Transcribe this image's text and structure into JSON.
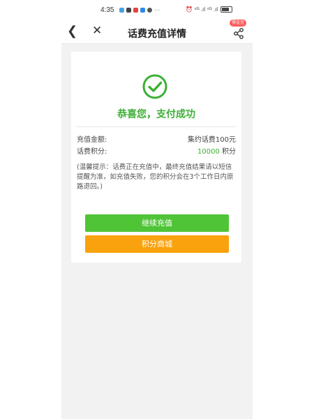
{
  "status_bar": {
    "time": "4:35",
    "right_indicators": "⏰ ⁴ᴳ .ıl ⁴ᴳ .ıl",
    "left_icon_colors": [
      "#4aa3df",
      "#444444",
      "#e0463b",
      "#2e8ae6",
      "#555555"
    ]
  },
  "navbar": {
    "title": "话费充值详情",
    "badge": "得金豆"
  },
  "result": {
    "message": "恭喜您，支付成功"
  },
  "details": {
    "amount_label": "充值金额:",
    "amount_value": "集约话费100元",
    "points_label": "话费积分:",
    "points_number": "10000",
    "points_unit": "积分"
  },
  "tip": "(温馨提示：话费正在充值中，最终充值结果请以短信提醒为准，如充值失败，您的积分会在3个工作日内原路退回。)",
  "buttons": {
    "continue": "继续充值",
    "mall": "积分商城"
  },
  "colors": {
    "success_green": "#3cb034",
    "button_green": "#4fc437",
    "button_orange": "#f9a20d"
  }
}
